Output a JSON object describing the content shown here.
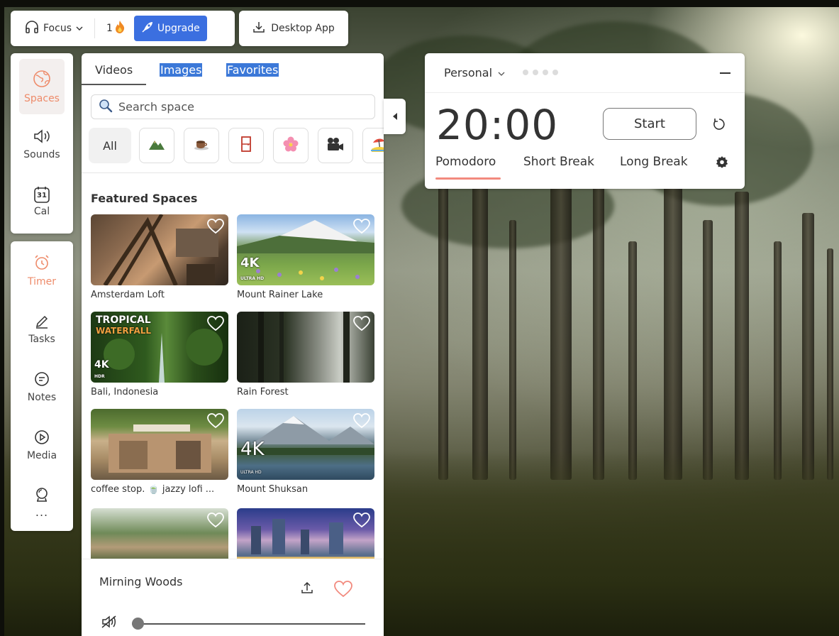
{
  "topbar": {
    "focus_label": "Focus",
    "streak_count": "1",
    "upgrade_label": "Upgrade",
    "desktop_label": "Desktop App"
  },
  "rail_top": {
    "spaces": "Spaces",
    "sounds": "Sounds",
    "cal": "Cal",
    "cal_day": "31"
  },
  "rail_bottom": {
    "timer": "Timer",
    "tasks": "Tasks",
    "notes": "Notes",
    "media": "Media",
    "more": "..."
  },
  "panel": {
    "tabs": [
      "Videos",
      "Images",
      "Favorites"
    ],
    "search_placeholder": "Search space",
    "chip_all": "All",
    "chip_icons": [
      "mountain-icon",
      "coffee-icon",
      "door-icon",
      "flower-icon",
      "camera-icon",
      "beach-icon"
    ],
    "featured_title": "Featured Spaces",
    "spaces": [
      {
        "name": "Amsterdam Loft"
      },
      {
        "name": "Mount Rainer Lake",
        "badge": "4K",
        "badge_sub": "ULTRA HD"
      },
      {
        "name": "Bali, Indonesia",
        "overlay": "TROPICAL",
        "overlay_sub": "WATERFALL",
        "badge": "4K",
        "badge_sub": "HDR"
      },
      {
        "name": "Rain Forest"
      },
      {
        "name": "coffee stop. 🍵 jazzy lofi ..."
      },
      {
        "name": "Mount Shuksan",
        "badge": "4K",
        "badge_sub": "ULTRA HD"
      },
      {
        "name": ""
      },
      {
        "name": ""
      }
    ]
  },
  "now_playing": {
    "title": "Mirning Woods",
    "volume": 0
  },
  "timer": {
    "profile": "Personal",
    "time": "20:00",
    "start_label": "Start",
    "modes": [
      "Pomodoro",
      "Short Break",
      "Long Break"
    ],
    "active_mode": "Pomodoro"
  },
  "colors": {
    "accent_upgrade": "#3b6fe0",
    "active_rail": "#ee8b6a",
    "pomodoro_underline": "#f28a7e",
    "heart": "#f28a7e"
  }
}
